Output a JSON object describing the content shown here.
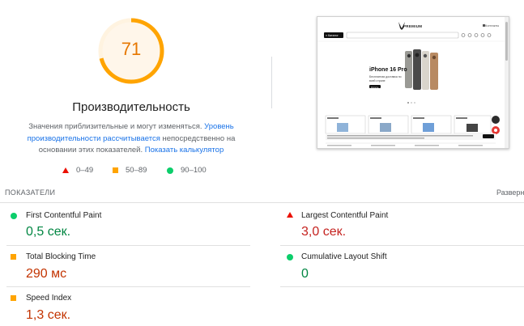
{
  "summary": {
    "score": "71",
    "score_fraction": 0.71,
    "title": "Производительность",
    "desc_part1": "Значения приблизительные и могут изменяться. ",
    "desc_link1": "Уровень производительности рассчитывается",
    "desc_part2": " непосредственно на основании этих показателей. ",
    "desc_link2": "Показать калькулятор"
  },
  "legend": [
    {
      "label": "0–49"
    },
    {
      "label": "50–89"
    },
    {
      "label": "90–100"
    }
  ],
  "screenshot": {
    "brand": "PREMIUM",
    "catalog_label": "≡ Каталог",
    "phone_label": "Контакты",
    "hero_title": "iPhone 16 Pro",
    "hero_sub": "Бесплатная доставка по всей стране",
    "hero_button": "Купить"
  },
  "metrics_section": {
    "label": "ПОКАЗАТЕЛИ",
    "expand": "Разверн"
  },
  "metrics": [
    {
      "name": "First Contentful Paint",
      "value": "0,5 сек."
    },
    {
      "name": "Largest Contentful Paint",
      "value": "3,0 сек."
    },
    {
      "name": "Total Blocking Time",
      "value": "290 мс"
    },
    {
      "name": "Cumulative Layout Shift",
      "value": "0"
    },
    {
      "name": "Speed Index",
      "value": "1,3 сек."
    }
  ],
  "colors": {
    "gauge_arc": "#ffa400",
    "gauge_bg": "#fff3e0",
    "good": "#0cce6b",
    "average": "#ffa400",
    "poor": "#eb0f00"
  }
}
